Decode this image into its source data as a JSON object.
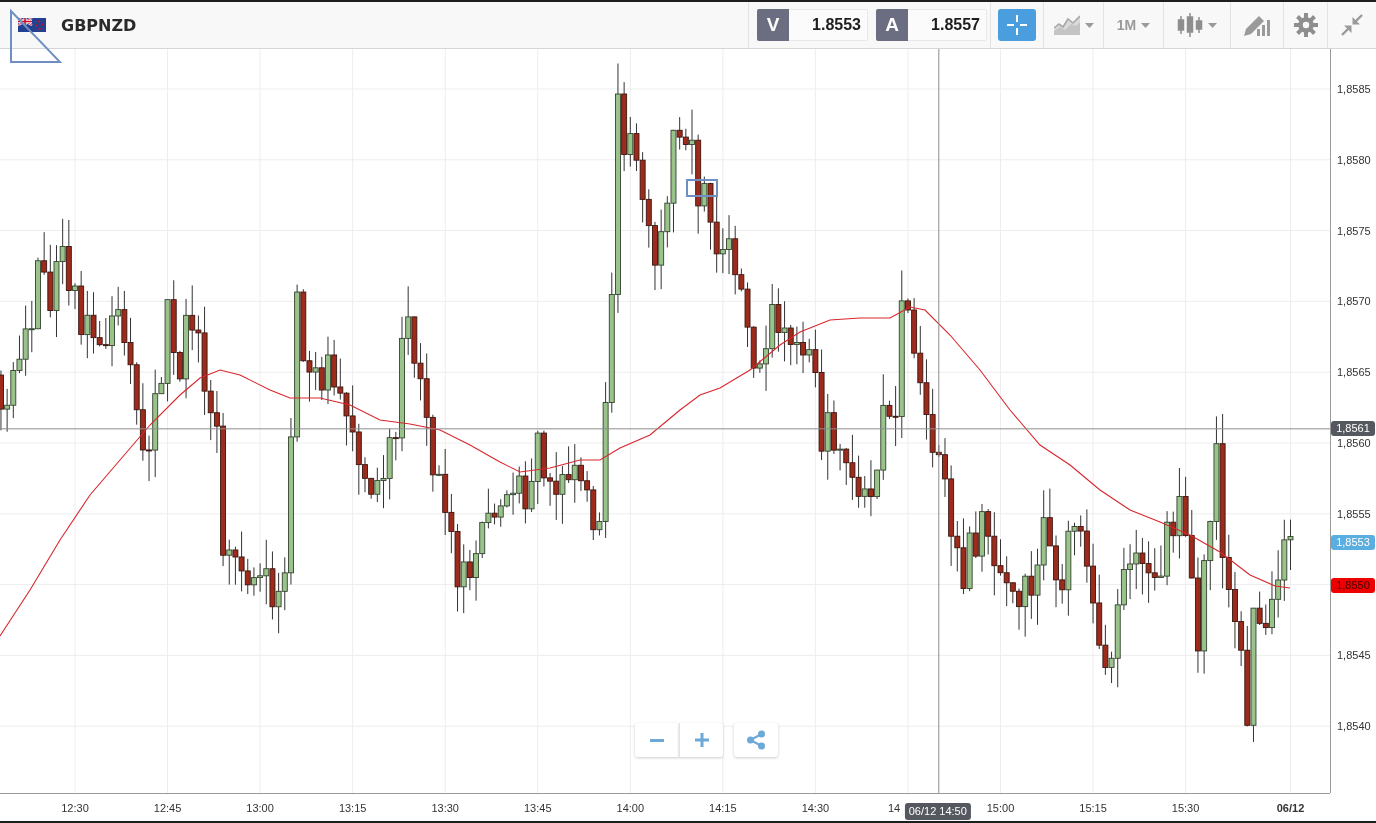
{
  "header": {
    "symbol": "GBPNZD"
  },
  "quotes": [
    {
      "label": "V",
      "value": "1.8553"
    },
    {
      "label": "A",
      "value": "1.8557"
    }
  ],
  "toolbar": [
    {
      "kind": "crosshair",
      "selected": true
    },
    {
      "kind": "chart_type",
      "selected": false
    },
    {
      "kind": "timeframe",
      "label": "1M",
      "selected": false
    },
    {
      "kind": "candle_style",
      "selected": false
    },
    {
      "kind": "drawing",
      "selected": false
    },
    {
      "kind": "settings",
      "selected": false
    },
    {
      "kind": "collapse",
      "selected": false
    }
  ],
  "price_axis": [
    {
      "kind": "tick",
      "label": "1,8585"
    },
    {
      "kind": "tick",
      "label": "1,8580"
    },
    {
      "kind": "tick",
      "label": "1,8575"
    },
    {
      "kind": "tick",
      "label": "1,8570"
    },
    {
      "kind": "tick",
      "label": "1,8565"
    },
    {
      "kind": "tick",
      "label": "1,8560"
    },
    {
      "kind": "tick",
      "label": "1,8555"
    },
    {
      "kind": "marker",
      "label": "1,8550",
      "color": "#ee0000"
    },
    {
      "kind": "tick",
      "label": "1,8545"
    },
    {
      "kind": "tick",
      "label": "1,8540"
    }
  ],
  "price_markers": [
    {
      "kind": "crosshair",
      "label": "1,8561",
      "color": "#55585f"
    },
    {
      "kind": "last_price",
      "label": "1,8553",
      "color": "#5aaee0"
    }
  ],
  "time_axis": [
    {
      "kind": "time",
      "label": "12:30"
    },
    {
      "kind": "time",
      "label": "12:45"
    },
    {
      "kind": "time",
      "label": "13:00"
    },
    {
      "kind": "time",
      "label": "13:15"
    },
    {
      "kind": "time",
      "label": "13:30"
    },
    {
      "kind": "time",
      "label": "13:45"
    },
    {
      "kind": "time",
      "label": "14:00"
    },
    {
      "kind": "time",
      "label": "14:15"
    },
    {
      "kind": "time",
      "label": "14:30"
    },
    {
      "kind": "cut",
      "label": "14"
    },
    {
      "kind": "time",
      "label": "15:00"
    },
    {
      "kind": "time",
      "label": "15:15"
    },
    {
      "kind": "time",
      "label": "15:30"
    },
    {
      "kind": "date",
      "label": "06/12"
    }
  ],
  "crosshair_time": "06/12 14:50"
}
